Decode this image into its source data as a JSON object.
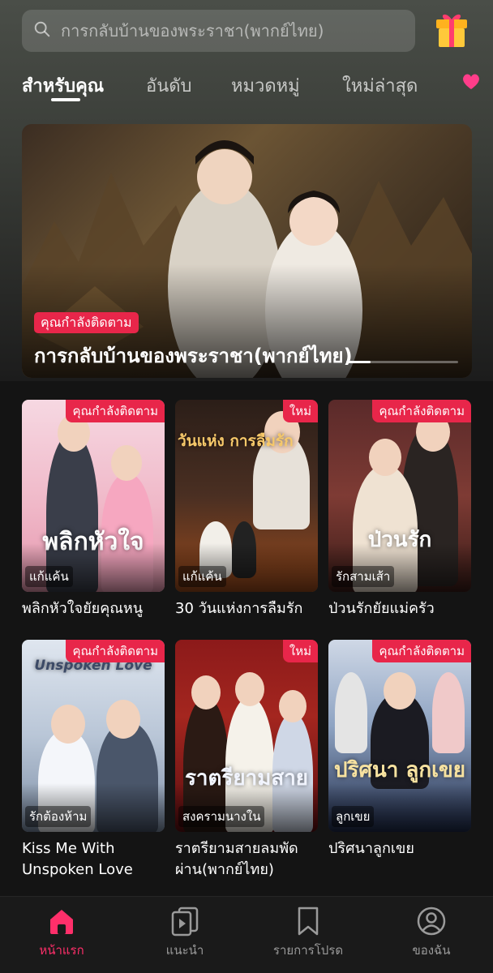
{
  "search": {
    "placeholder": "การกลับบ้านของพระราชา(พากย์ไทย)"
  },
  "tabs": [
    {
      "label": "สำหรับคุณ",
      "active": true
    },
    {
      "label": "อันดับ"
    },
    {
      "label": "หมวดหมู่"
    },
    {
      "label": "ใหม่ล่าสุด"
    },
    {
      "label": ""
    }
  ],
  "hero": {
    "badge": "คุณกำลังติดตาม",
    "title": "การกลับบ้านของพระราชา(พากย์ไทย)",
    "carousel_progress": 0.22
  },
  "cards": [
    {
      "title": "พลิกหัวใจยัยคุณหนู",
      "genre": "แก้แค้น",
      "tag": "คุณกำลังติดตาม",
      "art_text": "พลิกหัวใจ"
    },
    {
      "title": "30 วันแห่งการลืมรัก",
      "genre": "แก้แค้น",
      "tag": "ใหม่",
      "art_text": "30 วันแห่ง การลืมรัก"
    },
    {
      "title": "ป่วนรักยัยแม่ครัว",
      "genre": "รักสามเส้า",
      "tag": "คุณกำลังติดตาม",
      "art_text": "ป่วนรัก"
    },
    {
      "title": "Kiss Me With Unspoken Love",
      "genre": "รักต้องห้าม",
      "tag": "คุณกำลังติดตาม",
      "art_text": "Unspoken Love"
    },
    {
      "title": "ราตรียามสายลมพัดผ่าน(พากย์ไทย)",
      "genre": "สงครามนางใน",
      "tag": "ใหม่",
      "art_text": "ราตรียามสาย"
    },
    {
      "title": "ปริศนาลูกเขย",
      "genre": "ลูกเขย",
      "tag": "คุณกำลังติดตาม",
      "art_text": "ปริศนา ลูกเขย"
    }
  ],
  "bottom_nav": [
    {
      "label": "หน้าแรก",
      "icon": "home-icon",
      "active": true
    },
    {
      "label": "แนะนำ",
      "icon": "play-stack-icon"
    },
    {
      "label": "รายการโปรด",
      "icon": "bookmark-icon"
    },
    {
      "label": "ของฉัน",
      "icon": "profile-icon"
    }
  ],
  "colors": {
    "accent": "#e8264a",
    "nav_active": "#ff2f6a"
  }
}
